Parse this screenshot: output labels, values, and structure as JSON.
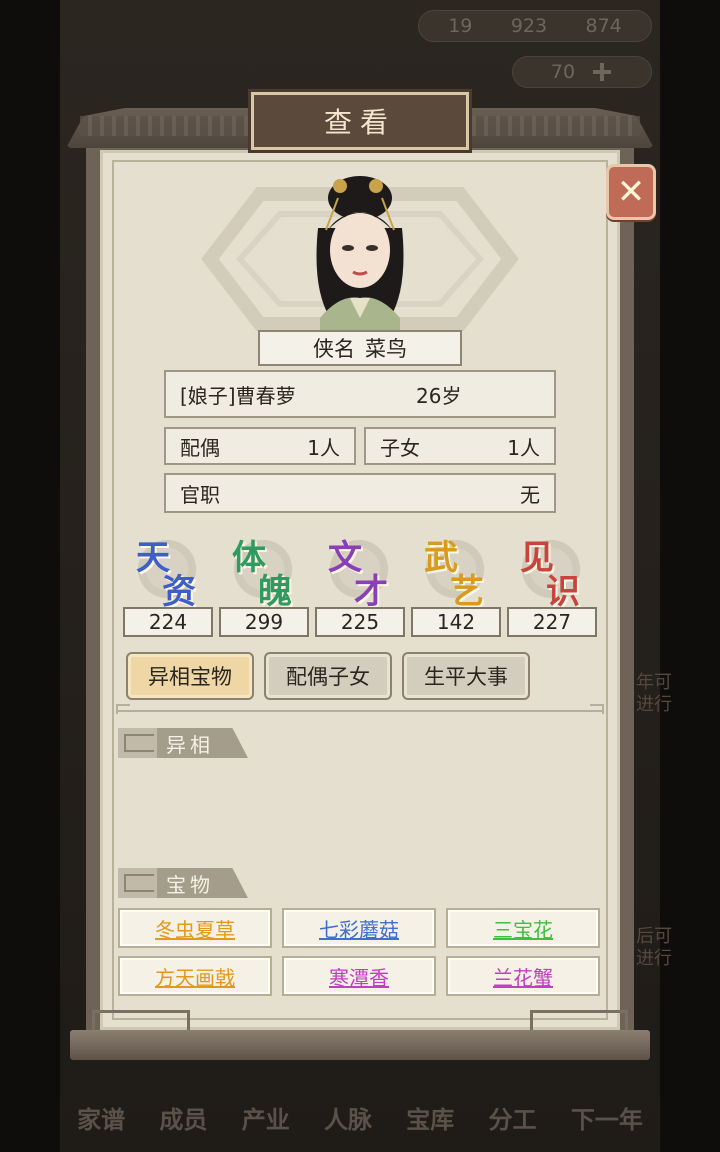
{
  "background": {
    "resources": [
      "19",
      "923",
      "874"
    ],
    "gold": "70",
    "hint_right_1": "年可\n进行",
    "hint_right_2": "后可\n进行",
    "bottom_nav": [
      "家谱",
      "成员",
      "产业",
      "人脉",
      "宝库",
      "分工",
      "下一年"
    ]
  },
  "dialog": {
    "title": "查看",
    "close_icon": "close-x-icon",
    "member": {
      "name_label": "侠名",
      "name_value": "菜鸟",
      "identity": "[娘子]曹春萝",
      "age": "26岁",
      "spouse_label": "配偶",
      "spouse_value": "1人",
      "children_label": "子女",
      "children_value": "1人",
      "office_label": "官职",
      "office_value": "无"
    },
    "attributes": [
      {
        "c1": "天",
        "c2": "资",
        "value": "224",
        "color": "#3e5fc7"
      },
      {
        "c1": "体",
        "c2": "魄",
        "value": "299",
        "color": "#2f9a62"
      },
      {
        "c1": "文",
        "c2": "才",
        "value": "225",
        "color": "#8a3fb5"
      },
      {
        "c1": "武",
        "c2": "艺",
        "value": "142",
        "color": "#d99a1e"
      },
      {
        "c1": "见",
        "c2": "识",
        "value": "227",
        "color": "#c9443c"
      }
    ],
    "tabs": [
      {
        "label": "异相宝物",
        "active": true
      },
      {
        "label": "配偶子女",
        "active": false
      },
      {
        "label": "生平大事",
        "active": false
      }
    ],
    "sections": {
      "traits_title": "异相",
      "treasures_title": "宝物"
    },
    "treasures": [
      {
        "label": "冬虫夏草",
        "color": "#e29a1b"
      },
      {
        "label": "七彩蘑菇",
        "color": "#3f6fd1"
      },
      {
        "label": "三宝花",
        "color": "#3fbf3f"
      },
      {
        "label": "方天画戟",
        "color": "#e29a1b"
      },
      {
        "label": "寒潭香",
        "color": "#c23ec2"
      },
      {
        "label": "兰花蟹",
        "color": "#c23ec2"
      }
    ]
  }
}
